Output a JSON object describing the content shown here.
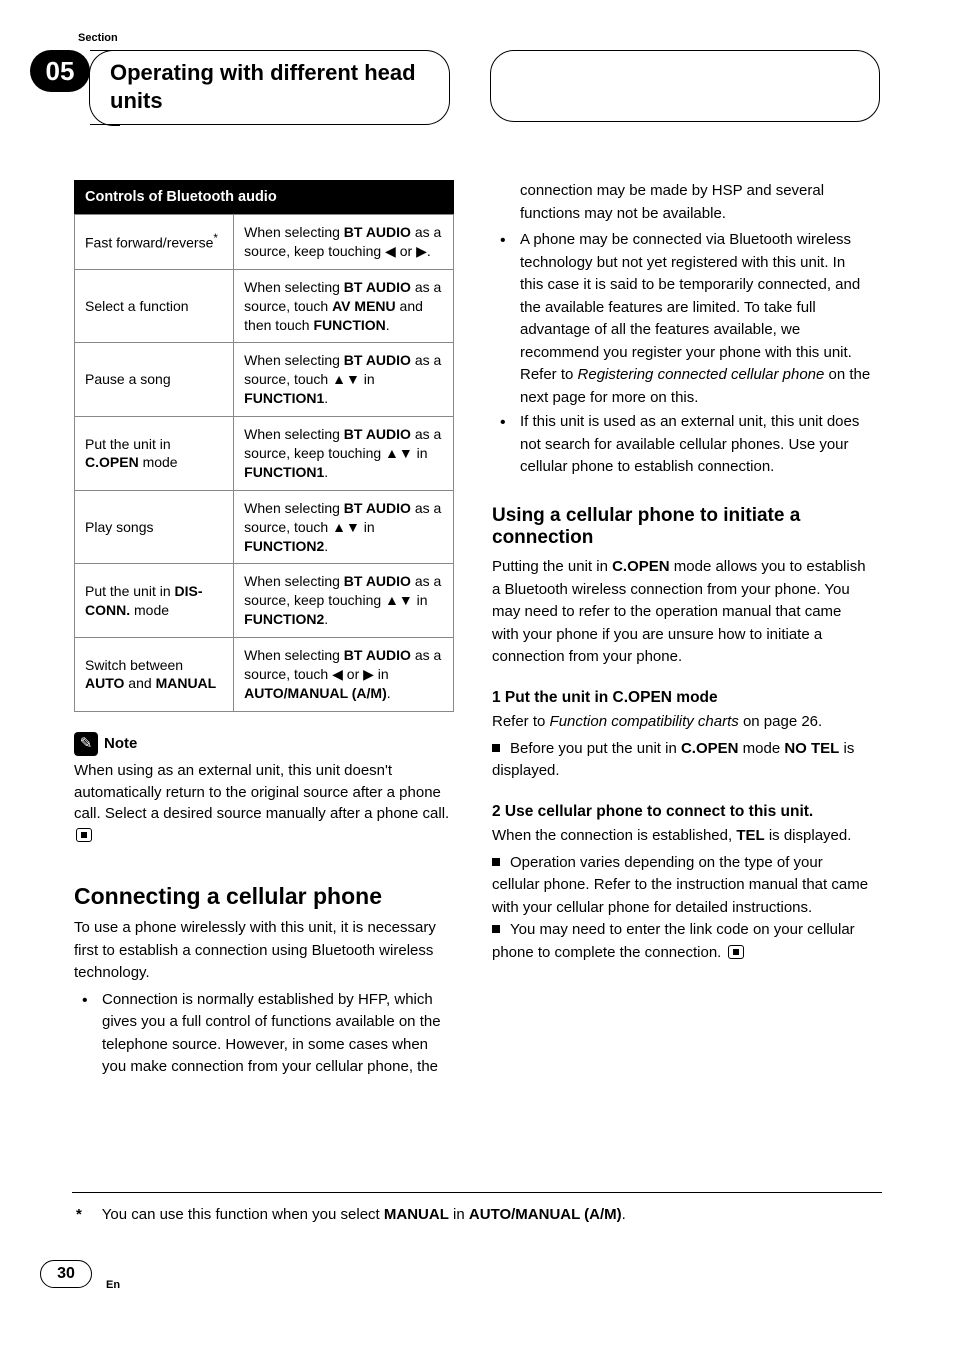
{
  "header": {
    "section_label": "Section",
    "section_number": "05",
    "title": "Operating with different head units"
  },
  "table": {
    "header": "Controls of Bluetooth audio",
    "rows": [
      {
        "label_html": "Fast forward/reverse<sup>*</sup>",
        "desc_html": "When selecting <b>BT AUDIO</b> as a source, keep touching <span class='tri'>◀</span> or <span class='tri'>▶</span>."
      },
      {
        "label_html": "Select a function",
        "desc_html": "When selecting <b>BT AUDIO</b> as a source, touch <b>AV MENU</b> and then touch <b>FUNCTION</b>."
      },
      {
        "label_html": "Pause a song",
        "desc_html": "When selecting <b>BT AUDIO</b> as a source, touch <span class='tri'>▲▼</span> in <b>FUNCTION1</b>."
      },
      {
        "label_html": "Put the unit in <b>C.OPEN</b> mode",
        "desc_html": "When selecting <b>BT AUDIO</b> as a source, keep touching <span class='tri'>▲▼</span> in <b>FUNCTION1</b>."
      },
      {
        "label_html": "Play songs",
        "desc_html": "When selecting <b>BT AUDIO</b> as a source, touch <span class='tri'>▲▼</span> in <b>FUNCTION2</b>."
      },
      {
        "label_html": "Put the unit in <b>DIS-CONN.</b> mode",
        "desc_html": "When selecting <b>BT AUDIO</b> as a source, keep touching <span class='tri'>▲▼</span> in <b>FUNCTION2</b>."
      },
      {
        "label_html": "Switch between <b>AUTO</b> and <b>MANUAL</b>",
        "desc_html": "When selecting <b>BT AUDIO</b> as a source, touch <span class='tri'>◀</span> or <span class='tri'>▶</span> in <b>AUTO/MANUAL (A/M)</b>."
      }
    ]
  },
  "note": {
    "label": "Note",
    "text_html": "When using as an external unit, this unit doesn't automatically return to the original source after a phone call. Select a desired source manually after a phone call. <span class='end-icon'></span>"
  },
  "connecting": {
    "title": "Connecting a cellular phone",
    "intro": "To use a phone wirelessly with this unit, it is necessary first to establish a connection using Bluetooth wireless technology.",
    "bullets_html": [
      "Connection is normally established by HFP, which gives you a full control of functions available on the telephone source. However, in some cases when you make connection from your cellular phone, the"
    ]
  },
  "right_top_bullets_html": [
    "connection may be made by HSP and several functions may not be available.",
    "A phone may be connected via Bluetooth wireless technology but not yet registered with this unit. In this case it is said to be temporarily connected, and the available features are limited. To take full advantage of all the features available, we recommend you register your phone with this unit. Refer to <span class='italic'>Registering connected cellular phone</span> on the next page for more on this.",
    "If this unit is used as an external unit, this unit does not search for available cellular phones. Use your cellular phone to establish connection."
  ],
  "using": {
    "title": "Using a cellular phone to initiate a connection",
    "intro_html": "Putting the unit in <b>C.OPEN</b> mode allows you to establish a Bluetooth wireless connection from your phone. You may need to refer to the operation manual that came with your phone if you are unsure how to initiate a connection from your phone.",
    "step1_hd": "1    Put the unit in C.OPEN mode",
    "step1_body_html": "Refer to <span class='italic'>Function compatibility charts</span> on page 26.",
    "step1_sq_html": "Before you put the unit in <b>C.OPEN</b> mode <b>NO TEL</b> is displayed.",
    "step2_hd": "2    Use cellular phone to connect to this unit.",
    "step2_body_html": "When the connection is established, <b>TEL</b> is displayed.",
    "step2_sq1_html": "Operation varies depending on the type of your cellular phone. Refer to the instruction manual that came with your cellular phone for detailed instructions.",
    "step2_sq2_html": "You may need to enter the link code on your cellular phone to complete the connection. <span class='end-icon'></span>"
  },
  "footnote_html": "You can use this function when you select <b>MANUAL</b> in <b>AUTO/MANUAL (A/M)</b>.",
  "footer": {
    "page": "30",
    "lang": "En"
  }
}
